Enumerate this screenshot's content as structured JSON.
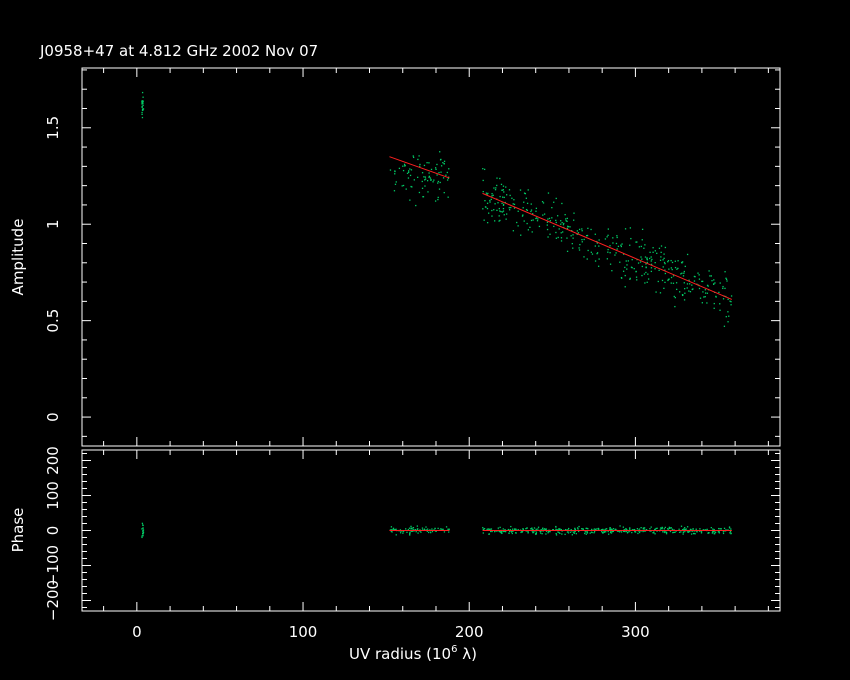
{
  "chart_data": {
    "type": "scatter",
    "title": "J0958+47 at 4.812 GHz 2002 Nov 07",
    "xlabel": "UV radius  (10",
    "xlabel_exp": "6",
    "xlabel_unit": " λ)",
    "xlim": [
      -33,
      387
    ],
    "xticks": [
      0,
      100,
      200,
      300
    ],
    "x_tick_labels": [
      "0",
      "100",
      "200",
      "300"
    ],
    "panels": [
      {
        "name": "amplitude",
        "ylabel": "Amplitude",
        "ylim": [
          -0.15,
          1.81
        ],
        "yticks": [
          0,
          0.5,
          1,
          1.5
        ],
        "y_tick_labels": [
          "0",
          "0.5",
          "1",
          "1.5"
        ],
        "data_color": "#00cc66",
        "model_color": "#ff2020",
        "clusters": [
          {
            "x_range": [
              3,
              4
            ],
            "y_center": 1.62,
            "spread": 0.03,
            "count": 25
          },
          {
            "x_range": [
              152,
              188
            ],
            "y_center": 1.25,
            "spread": 0.06,
            "count": 90
          },
          {
            "x_range": [
              208,
              358
            ],
            "y_center": "model",
            "spread": 0.06,
            "count": 420
          }
        ],
        "model_segments": [
          {
            "x": [
              152,
              188
            ],
            "y": [
              1.35,
              1.24
            ]
          },
          {
            "x": [
              208,
              358
            ],
            "y": [
              1.16,
              0.61
            ]
          }
        ]
      },
      {
        "name": "phase",
        "ylabel": "Phase",
        "ylim": [
          -230,
          230
        ],
        "yticks": [
          -200,
          -100,
          0,
          100,
          200
        ],
        "y_tick_labels": [
          "−200",
          "−100",
          "0",
          "100",
          "200"
        ],
        "data_color": "#00cc66",
        "model_color": "#ff2020",
        "clusters": [
          {
            "x_range": [
              3,
              4
            ],
            "y_center": 0,
            "spread": 10,
            "count": 20
          },
          {
            "x_range": [
              152,
              188
            ],
            "y_center": 0,
            "spread": 5,
            "count": 90
          },
          {
            "x_range": [
              208,
              358
            ],
            "y_center": 0,
            "spread": 5,
            "count": 420
          }
        ],
        "model_segments": [
          {
            "x": [
              152,
              188
            ],
            "y": [
              0,
              0
            ]
          },
          {
            "x": [
              208,
              358
            ],
            "y": [
              0,
              0
            ]
          }
        ]
      }
    ]
  }
}
